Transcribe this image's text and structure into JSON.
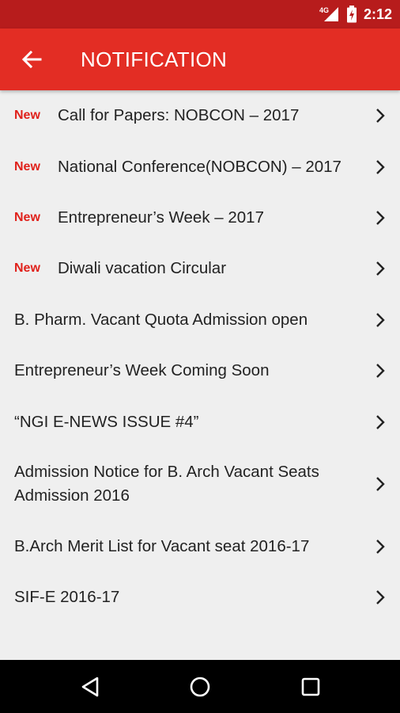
{
  "status_bar": {
    "network": "4G",
    "time": "2:12",
    "icons": [
      "signal-icon",
      "battery-icon"
    ]
  },
  "app_bar": {
    "title": "NOTIFICATION",
    "back_icon": "arrow-back-icon"
  },
  "notifications": [
    {
      "badge": "New",
      "label": "Call for Papers: NOBCON – 2017"
    },
    {
      "badge": "New",
      "label": "National Conference(NOBCON) – 2017"
    },
    {
      "badge": "New",
      "label": "Entrepreneur’s Week – 2017"
    },
    {
      "badge": "New",
      "label": "Diwali vacation Circular"
    },
    {
      "badge": "",
      "label": "B. Pharm. Vacant Quota Admission open"
    },
    {
      "badge": "",
      "label": "Entrepreneur’s Week Coming Soon"
    },
    {
      "badge": "",
      "label": "“NGI E-NEWS ISSUE #4”"
    },
    {
      "badge": "",
      "label": "Admission Notice for B. Arch Vacant Seats Admission 2016"
    },
    {
      "badge": "",
      "label": "B.Arch Merit List for Vacant seat 2016-17"
    },
    {
      "badge": "",
      "label": "SIF-E 2016-17"
    }
  ],
  "nav_bar": {
    "buttons": [
      "back-triangle-icon",
      "home-circle-icon",
      "recents-square-icon"
    ]
  },
  "colors": {
    "status_bar": "#b71c1c",
    "app_bar": "#e32d24",
    "new_badge": "#e0211b",
    "background": "#efefef"
  }
}
